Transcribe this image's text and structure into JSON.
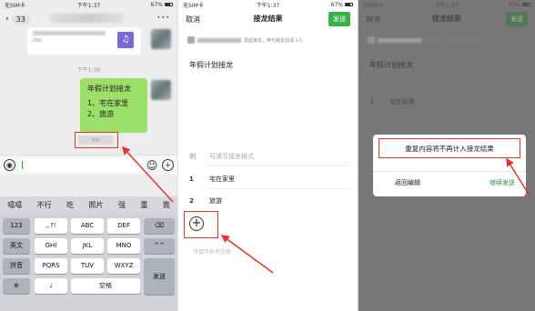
{
  "status": {
    "carrier": "无SIM卡",
    "time": "下午1:37",
    "battery": "67%"
  },
  "chat": {
    "unread_count": "33",
    "card_small_text": "29K",
    "timestamp": "下午1:36",
    "bubble_lines": [
      "年假计划接龙",
      "1、宅在家里",
      "2、旅游"
    ],
    "tiny_tag": "发送",
    "suggestions": [
      "嘻嘻",
      "不行",
      "吃",
      "照片",
      "强",
      "重",
      "我"
    ],
    "keyboard": {
      "row1": [
        "123",
        ",.?!",
        "ABC",
        "DEF"
      ],
      "row2": [
        "英文",
        "GHI",
        "JKL",
        "MNO",
        "^^"
      ],
      "row3": [
        "拼音",
        "PQRS",
        "TUV",
        "WXYZ"
      ],
      "row4_space": "空格",
      "send": "发送"
    }
  },
  "relay": {
    "cancel": "取消",
    "title": "接龙结果",
    "send": "发送",
    "info_suffix": "发起接龙，参与接龙前请 1人",
    "heading": "年假计划接龙",
    "example_num": "例",
    "example_placeholder": "可填写接龙格式",
    "items": [
      {
        "num": "1",
        "text": "宅在家里"
      },
      {
        "num": "2",
        "text": "旅游"
      }
    ],
    "supplement_placeholder": "可填写补充信息"
  },
  "modal": {
    "message": "重复内容将不再计入接龙结果",
    "cancel": "返回编辑",
    "confirm": "继续发送"
  },
  "colors": {
    "wechat_green": "#36b24a",
    "bubble_green": "#9de069",
    "annotation_red": "#e0352b"
  }
}
